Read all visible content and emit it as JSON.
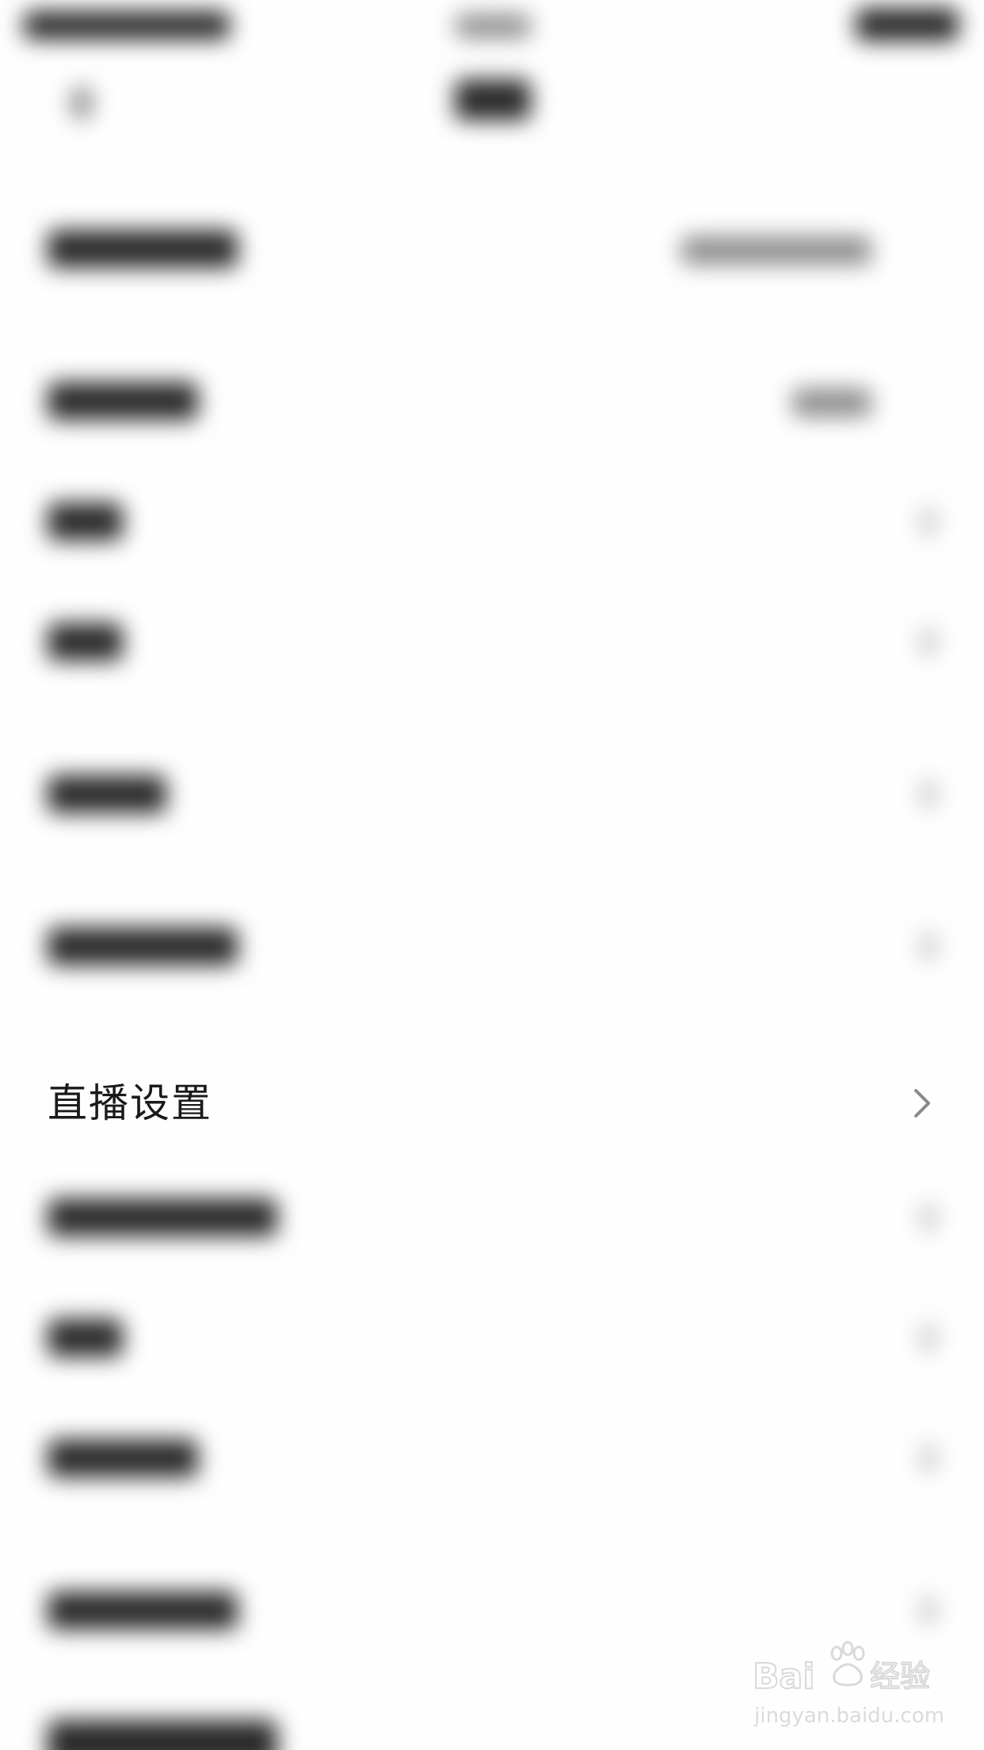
{
  "settings_list": {
    "focused_item": {
      "label": "直播设置"
    }
  },
  "watermark": {
    "brand": "Baidu经验",
    "url": "jingyan.baidu.com"
  }
}
